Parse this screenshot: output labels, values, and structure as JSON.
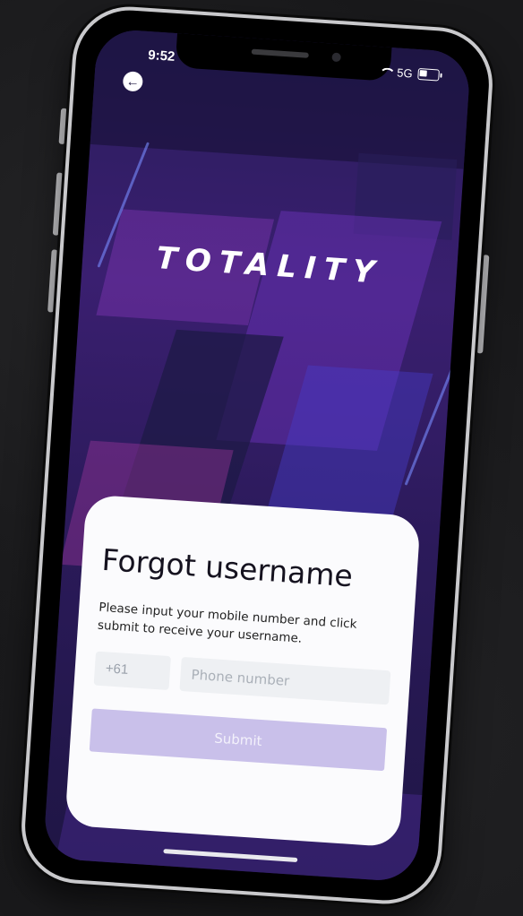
{
  "status_bar": {
    "time": "9:52",
    "network": "5G",
    "icons": [
      "wifi-icon",
      "battery-icon"
    ]
  },
  "header": {
    "back_icon": "arrow-left-icon",
    "back_glyph": "←"
  },
  "brand": {
    "logo_text": "TOTALITY"
  },
  "form": {
    "title": "Forgot username",
    "description": "Please input your mobile number and click submit to receive your username.",
    "country_code": "+61",
    "phone_placeholder": "Phone number",
    "phone_value": "",
    "submit_label": "Submit"
  },
  "colors": {
    "accent_disabled": "#c9c0ea",
    "background": "#1d1640",
    "card": "#fbfbfd"
  }
}
